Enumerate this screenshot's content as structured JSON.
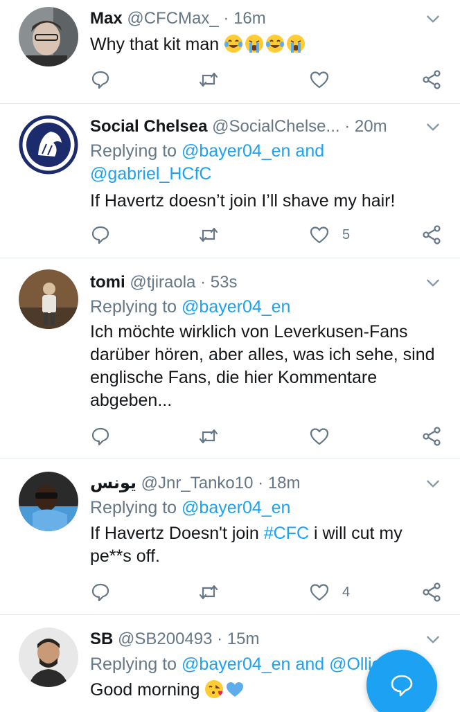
{
  "colors": {
    "link": "#1da1f2",
    "muted": "#657786",
    "text": "#14171a",
    "divider": "#e1e8ed"
  },
  "tweets": [
    {
      "name": "Max",
      "handle": "@CFCMax_",
      "dot": "·",
      "time": "16m",
      "text": "Why that kit man",
      "emoji": [
        "face-with-tears-of-joy",
        "loudly-crying-face",
        "face-with-tears-of-joy",
        "loudly-crying-face"
      ],
      "likes": ""
    },
    {
      "name": "Social Chelsea",
      "handle": "@SocialChelse...",
      "dot": "·",
      "time": "20m",
      "replying_prefix": "Replying to",
      "replying_links": [
        "@bayer04_en",
        "@gabriel_HCfC"
      ],
      "replying_joiner": "and",
      "text": "If Havertz doesn’t join I’ll shave my hair!",
      "likes": "5"
    },
    {
      "name": "tomi",
      "handle": "@tjiraola",
      "dot": "·",
      "time": "53s",
      "replying_prefix": "Replying to",
      "replying_links": [
        "@bayer04_en"
      ],
      "text_lines": [
        "Ich möchte wirklich von Leverkusen-Fans",
        "darüber hören, aber alles, was ich sehe, sind",
        "englische Fans, die hier Kommentare",
        "abgeben..."
      ],
      "likes": ""
    },
    {
      "name": "يونس",
      "handle": "@Jnr_Tanko10",
      "dot": "·",
      "time": "18m",
      "replying_prefix": "Replying to",
      "replying_links": [
        "@bayer04_en"
      ],
      "text_a": "If Havertz Doesn't join",
      "hashtag": "#CFC",
      "text_b": "i will cut my",
      "text_line2": "pe**s off.",
      "likes": "4"
    },
    {
      "name": "SB",
      "handle": "@SB200493",
      "dot": "·",
      "time": "15m",
      "replying_prefix": "Replying to",
      "replying_links": [
        "@bayer04_en",
        "@Ollie"
      ],
      "replying_joiner": "and",
      "replying_tail": "ll",
      "text": "Good morning",
      "emoji": [
        "face-blowing-a-kiss",
        "blue-heart"
      ]
    }
  ],
  "icons": {
    "reply": "reply-icon",
    "retweet": "retweet-icon",
    "like": "heart-icon",
    "share": "share-icon",
    "caret": "chevron-down-icon",
    "compose": "compose-message-icon"
  }
}
